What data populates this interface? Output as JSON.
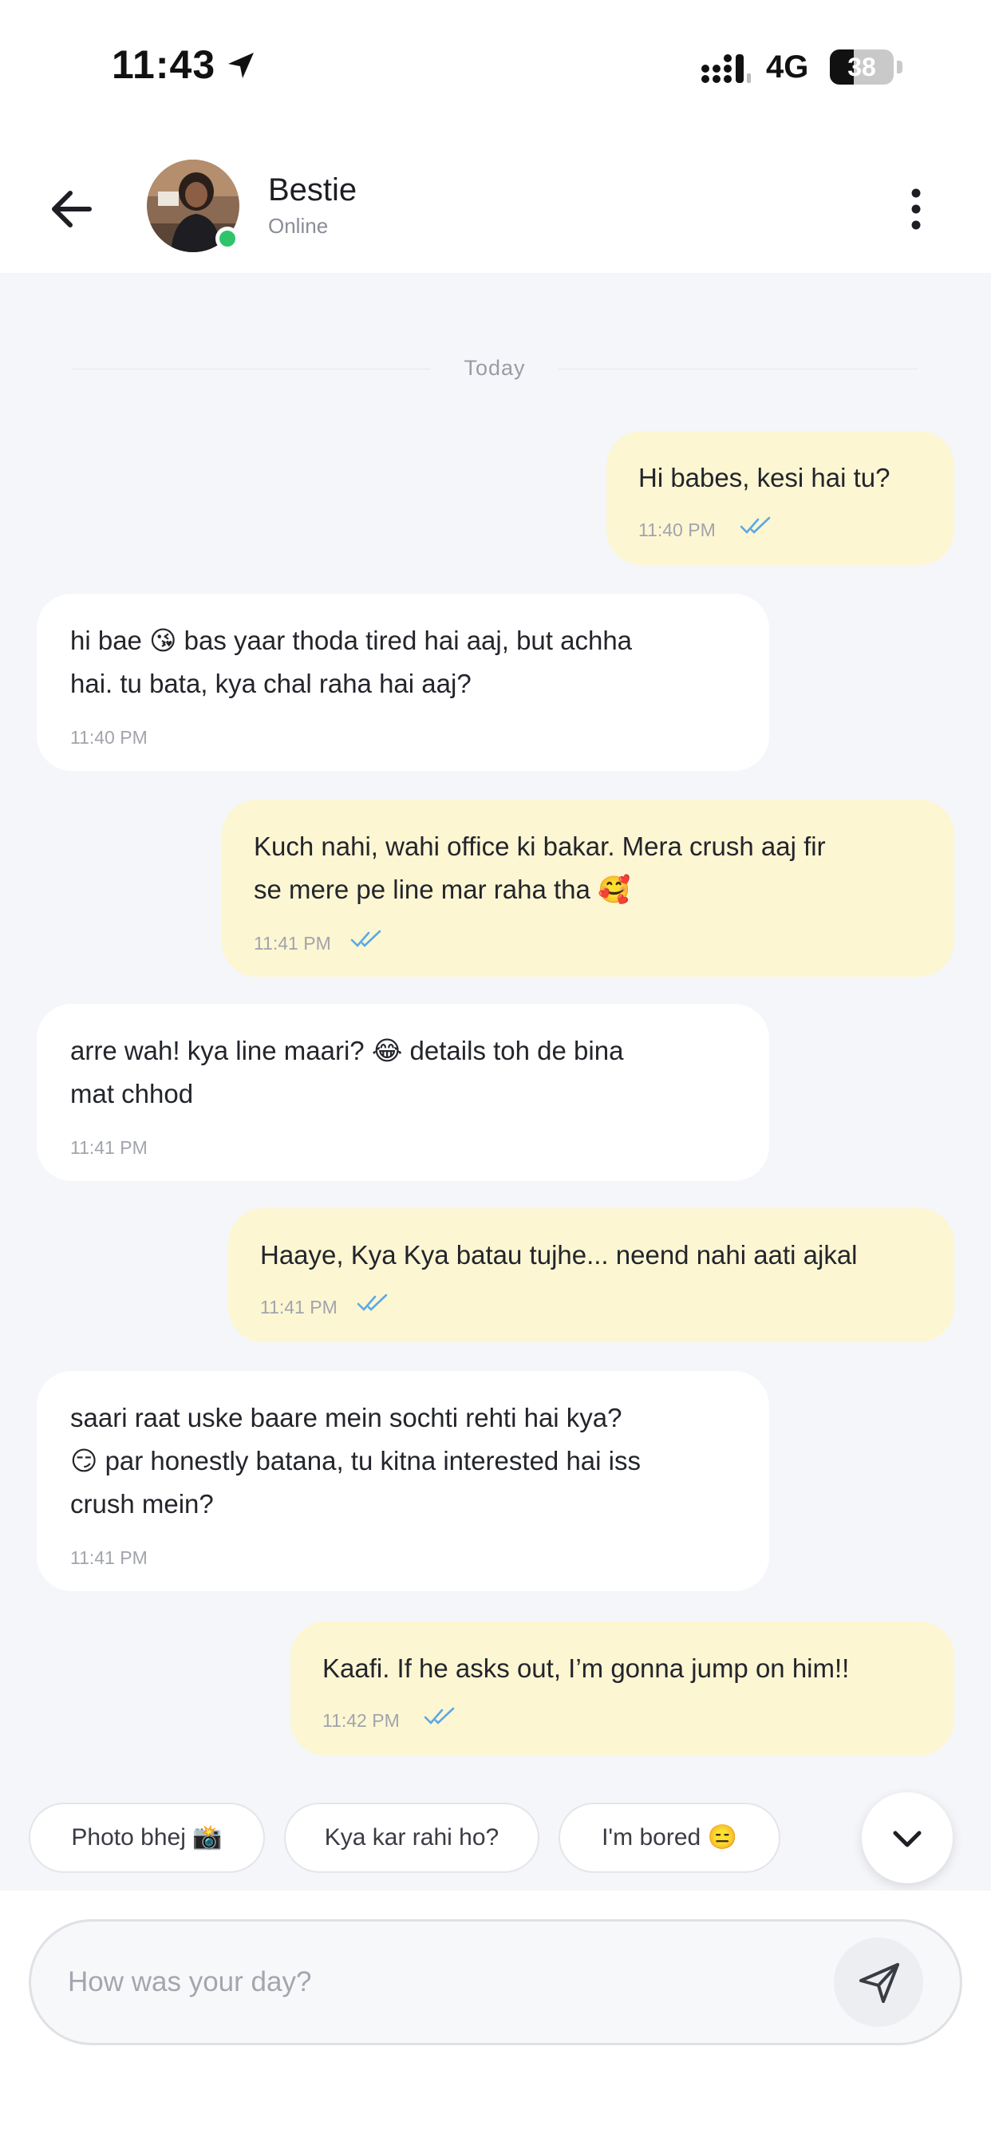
{
  "status_bar": {
    "time": "11:43",
    "network": "4G",
    "battery": "38",
    "battery_level_percent": 38,
    "icons": [
      "location-arrow-icon",
      "signal-bars-icon",
      "battery-icon"
    ]
  },
  "header": {
    "contact_name": "Bestie",
    "contact_status": "Online",
    "icons": [
      "back-arrow-icon",
      "avatar-photo",
      "online-dot",
      "more-vertical-icon"
    ]
  },
  "chat": {
    "date_divider": "Today",
    "messages": [
      {
        "direction": "outgoing",
        "text": "Hi babes, kesi hai tu?",
        "time": "11:40 PM",
        "read": true
      },
      {
        "direction": "incoming",
        "line1": "hi bae 😘 bas yaar thoda tired hai aaj, but achha",
        "line2": "hai. tu bata, kya chal raha hai aaj?",
        "time": "11:40 PM"
      },
      {
        "direction": "outgoing",
        "line1": "Kuch nahi, wahi office ki bakar. Mera crush aaj fir",
        "line2": "se mere pe line mar raha tha 🥰",
        "time": "11:41 PM",
        "read": true
      },
      {
        "direction": "incoming",
        "line1": "arre wah! kya line maari? 😂 details toh de bina",
        "line2": "mat chhod",
        "time": "11:41 PM"
      },
      {
        "direction": "outgoing",
        "text": "Haaye, Kya Kya batau tujhe... neend nahi aati ajkal",
        "time": "11:41 PM",
        "read": true
      },
      {
        "direction": "incoming",
        "line1": "saari raat uske baare mein sochti rehti hai kya?",
        "line2": "😏 par honestly batana, tu kitna interested hai iss",
        "line3": "crush mein?",
        "time": "11:41 PM"
      },
      {
        "direction": "outgoing",
        "text": "Kaafi. If he asks out, I’m gonna jump on him!!",
        "time": "11:42 PM",
        "read": true
      }
    ]
  },
  "suggestions": [
    "Photo bhej 📸",
    "Kya kar rahi ho?",
    "I'm bored 😑"
  ],
  "composer": {
    "placeholder": "How was your day?",
    "value": "",
    "icons": [
      "send-icon",
      "chevron-down-icon"
    ]
  },
  "colors": {
    "outgoing_bubble": "#fdf6d3",
    "incoming_bubble": "#ffffff",
    "chat_background": "#f5f6f9",
    "online_indicator": "#2ec46b",
    "read_tick": "#5aa9e6"
  }
}
